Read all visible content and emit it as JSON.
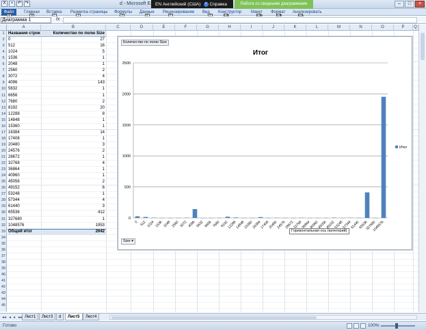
{
  "title": {
    "qat": [
      "save",
      "undo",
      "redo"
    ],
    "doc": "d  -  Microsoft Excel",
    "lang": "EN Английский (США)",
    "help": "Справка",
    "context": "Работа со сводными диаграммами"
  },
  "ribbon": {
    "tabs": [
      {
        "label": "Файл",
        "x": 2,
        "key": "Ф"
      },
      {
        "label": "Главная",
        "x": 35,
        "key": "Я"
      },
      {
        "label": "Вставка",
        "x": 68,
        "key": "С"
      },
      {
        "label": "Разметка страницы",
        "x": 103,
        "key": "З"
      },
      {
        "label": "Формулы",
        "x": 167,
        "key": "Л"
      },
      {
        "label": "Данные",
        "x": 204,
        "key": "Ё"
      },
      {
        "label": "Рецензирование",
        "x": 238,
        "key": "Р"
      },
      {
        "label": "Вид",
        "x": 296,
        "key": "О"
      },
      {
        "label": "Конструктор",
        "x": 319,
        "key": "ЫК"
      },
      {
        "label": "Макет",
        "x": 367,
        "key": "ЫМ"
      },
      {
        "label": "Формат",
        "x": 396,
        "key": "ЫФ"
      },
      {
        "label": "Анализировать",
        "x": 428,
        "key": "ЫА"
      }
    ]
  },
  "formula": {
    "name_box": "Диаграмма 1",
    "fx": "fx",
    "value": ""
  },
  "columns": [
    "A",
    "B",
    "C",
    "D",
    "E",
    "F",
    "G",
    "H",
    "I",
    "J",
    "K",
    "L",
    "M",
    "N",
    "O",
    "P",
    "Q"
  ],
  "table": {
    "header_a": "Названия строк",
    "header_b": "Количество по полю  Size",
    "rows": [
      [
        "0",
        "27"
      ],
      [
        "512",
        "16"
      ],
      [
        "1024",
        "5"
      ],
      [
        "1536",
        "1"
      ],
      [
        "2048",
        "1"
      ],
      [
        "2560",
        "2"
      ],
      [
        "3072",
        "4"
      ],
      [
        "4096",
        "143"
      ],
      [
        "5632",
        "1"
      ],
      [
        "6656",
        "1"
      ],
      [
        "7680",
        "2"
      ],
      [
        "8192",
        "20"
      ],
      [
        "12288",
        "8"
      ],
      [
        "14848",
        "1"
      ],
      [
        "15360",
        "1"
      ],
      [
        "16384",
        "14"
      ],
      [
        "17408",
        "1"
      ],
      [
        "20480",
        "3"
      ],
      [
        "24576",
        "2"
      ],
      [
        "28672",
        "1"
      ],
      [
        "32768",
        "4"
      ],
      [
        "36864",
        "1"
      ],
      [
        "40960",
        "1"
      ],
      [
        "45056",
        "2"
      ],
      [
        "49152",
        "6"
      ],
      [
        "53248",
        "1"
      ],
      [
        "57344",
        "4"
      ],
      [
        "61440",
        "3"
      ],
      [
        "65536",
        "412"
      ],
      [
        "327680",
        "1"
      ],
      [
        "1048576",
        "1953"
      ]
    ],
    "total_label": "Общий итог",
    "total_value": "2642"
  },
  "chart": {
    "field_button": "Количество по полю  Size",
    "axis_button": "Size",
    "tooltip": "Горизонтальная ось (категорий)"
  },
  "chart_data": {
    "type": "bar",
    "title": "Итог",
    "categories": [
      "0",
      "512",
      "1024",
      "1536",
      "2048",
      "2560",
      "3072",
      "4096",
      "5632",
      "6656",
      "7680",
      "8192",
      "12288",
      "14848",
      "15360",
      "16384",
      "17408",
      "20480",
      "24576",
      "28672",
      "32768",
      "36864",
      "40960",
      "45056",
      "49152",
      "53248",
      "57344",
      "61440",
      "65536",
      "327680",
      "1048576"
    ],
    "series": [
      {
        "name": "Итог",
        "values": [
          27,
          16,
          5,
          1,
          1,
          2,
          4,
          143,
          1,
          1,
          2,
          20,
          8,
          1,
          1,
          14,
          1,
          3,
          2,
          1,
          4,
          1,
          1,
          2,
          6,
          1,
          4,
          3,
          412,
          1,
          1953
        ]
      }
    ],
    "ylim": [
      0,
      2500
    ],
    "yticks": [
      0,
      500,
      1000,
      1500,
      2000,
      2500
    ],
    "grid": true,
    "legend": "right",
    "bar_color": "#4f81bd"
  },
  "sheets": {
    "tabs": [
      "Лист1",
      "Лист3",
      "d",
      "Лист5",
      "Лист4"
    ],
    "active": "Лист5"
  },
  "status": {
    "ready": "Готово",
    "zoom": "100%"
  }
}
